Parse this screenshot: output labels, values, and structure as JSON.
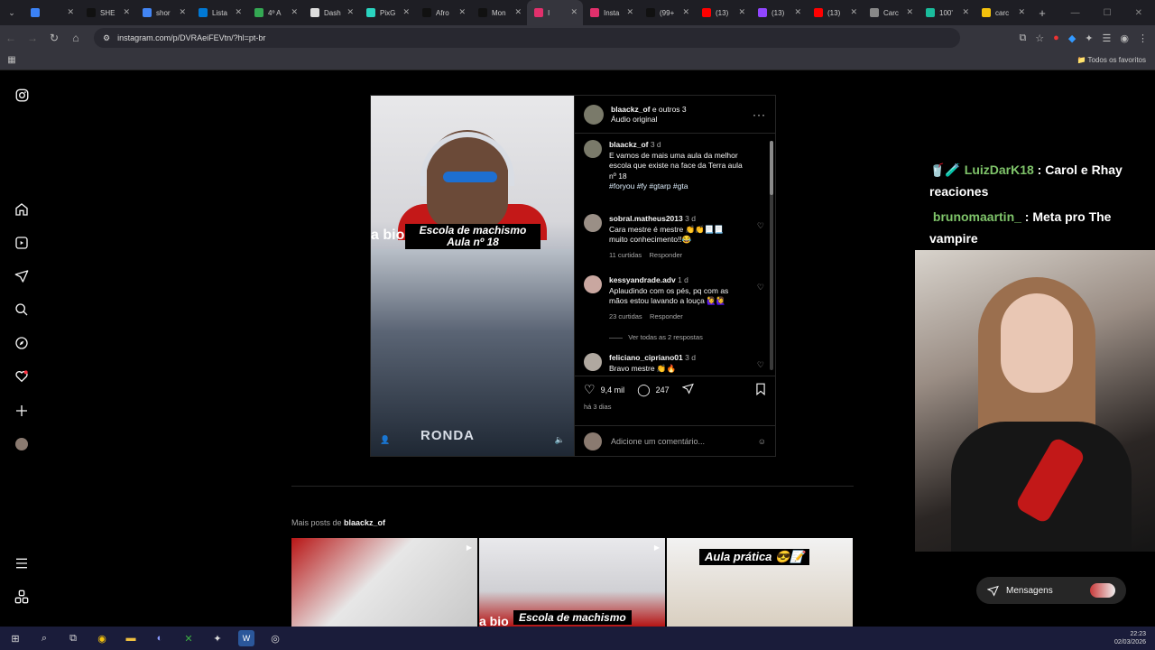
{
  "browser": {
    "tabs": [
      {
        "label": "",
        "color": "#3b82f6"
      },
      {
        "label": "SHE",
        "color": "#111111"
      },
      {
        "label": "shor",
        "color": "#4285f4"
      },
      {
        "label": "Lista",
        "color": "#0078d4"
      },
      {
        "label": "4º A",
        "color": "#34a853"
      },
      {
        "label": "Dash",
        "color": "#dddddd"
      },
      {
        "label": "PixG",
        "color": "#2ad4c0"
      },
      {
        "label": "Afro",
        "color": "#111111"
      },
      {
        "label": "Mon",
        "color": "#111111"
      },
      {
        "label": "I",
        "color": "#e1306c"
      },
      {
        "label": "Insta",
        "color": "#e1306c"
      },
      {
        "label": "(99+",
        "color": "#111111"
      },
      {
        "label": "(13)",
        "color": "#ff0000"
      },
      {
        "label": "(13)",
        "color": "#9146ff"
      },
      {
        "label": "(13)",
        "color": "#ff0000"
      },
      {
        "label": "Carc",
        "color": "#888888"
      },
      {
        "label": "100'",
        "color": "#1abc9c"
      },
      {
        "label": "carc",
        "color": "#f4c20d"
      }
    ],
    "url": "instagram.com/p/DVRAeiFEVtn/?hl=pt-br",
    "bookmarks_all": "Todos os favoritos"
  },
  "post": {
    "header_user": "blaackz_of",
    "header_suffix": " e outros 3",
    "audio": "Áudio original",
    "video_caption_line1": "Escola de machismo",
    "video_caption_line2": "Aula nº 18",
    "video_side_text": "a bio",
    "video_badge": "RONDA",
    "caption_user": "blaackz_of",
    "caption_time": "3 d",
    "caption_text": "E vamos de mais uma aula da melhor escola que existe na face da Terra aula nº 18",
    "caption_tags": "#foryou #fy #gtarp #gta",
    "comments": [
      {
        "user": "sobral.matheus2013",
        "time": "3 d",
        "text": "Cara mestre é mestre 👏👏📃📃 muito conhecimento!!😂",
        "likes": "11 curtidas",
        "reply": "Responder"
      },
      {
        "user": "kessyandrade.adv",
        "time": "1 d",
        "text": "Aplaudindo com os pés, pq com as mãos estou lavando a louça 🙋‍♀️🙋‍♀️",
        "likes": "23 curtidas",
        "reply": "Responder"
      },
      {
        "user": "feliciano_cipriano01",
        "time": "3 d",
        "text": "Bravo mestre 👏🔥"
      }
    ],
    "view_replies": "Ver todas as 2 respostas",
    "likes": "9,4 mil",
    "comment_count": "247",
    "posted_ago": "há 3 dias",
    "add_comment_placeholder": "Adicione um comentário..."
  },
  "more_posts": {
    "prefix": "Mais posts de ",
    "user": "blaackz_of",
    "thumbs": [
      {
        "caption": ""
      },
      {
        "caption": "Escola de machismo",
        "side": "a bio"
      },
      {
        "caption": "Aula prática 😎📝"
      }
    ]
  },
  "stream_chat": [
    {
      "user": "LuizDarK18",
      "message": " : Carol e Rhay reaciones"
    },
    {
      "user": "brunomaartin_",
      "message": " : Meta pro The vampire"
    }
  ],
  "messages_button": "Mensagens",
  "clock": {
    "time": "22:23",
    "date": "02/03/2026"
  }
}
